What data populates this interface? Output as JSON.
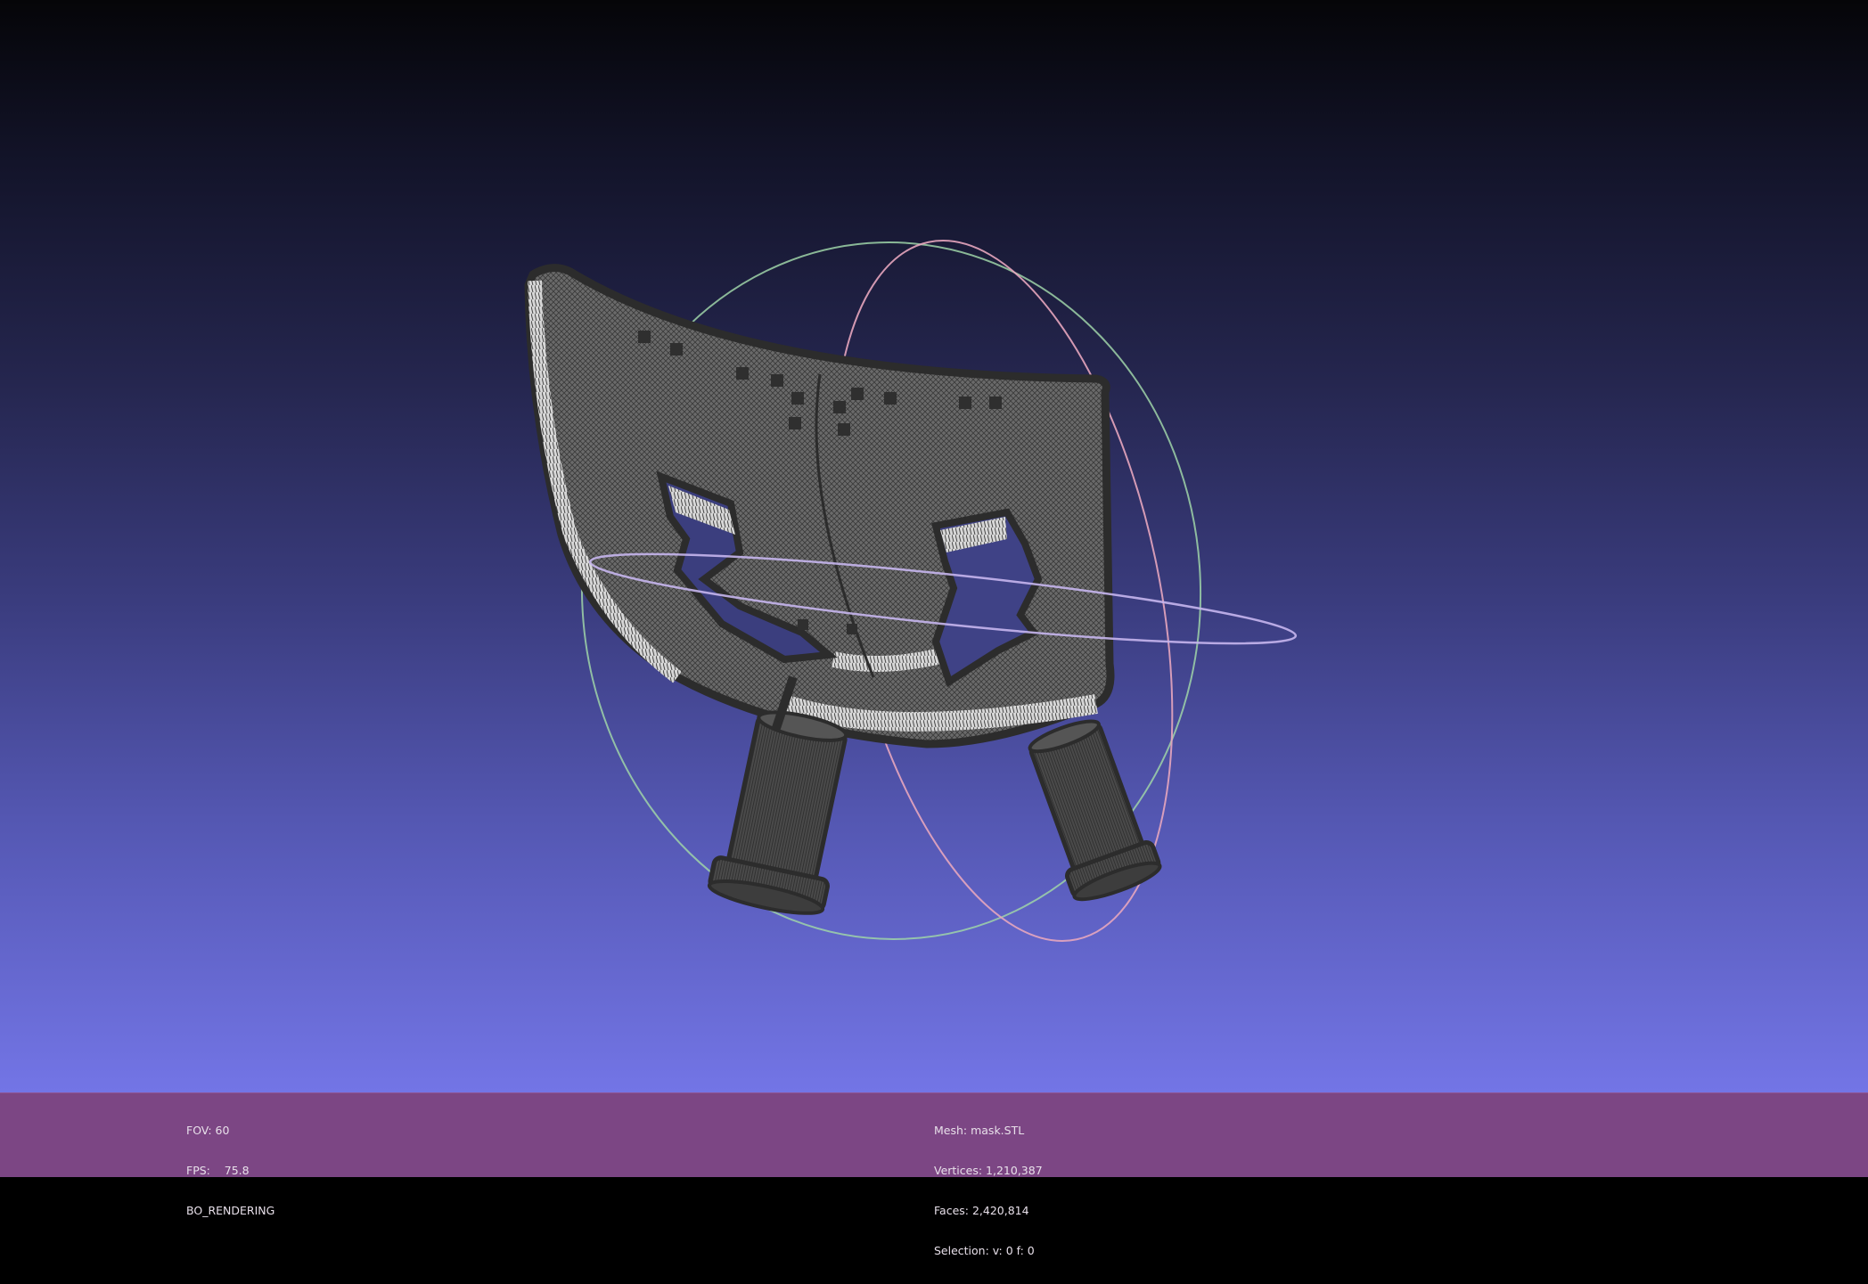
{
  "viewport": {
    "scene": "mesh-wireframe-viewer",
    "colors": {
      "bg_top": "#050508",
      "bg_bottom": "#7375e6",
      "mesh": "#5a5a5a",
      "mesh_edge": "#2f2f2f",
      "trackball_x": "#c8a9e8",
      "trackball_y": "#a8d8b0",
      "trackball_z": "#e8a0b8"
    }
  },
  "status_left": {
    "fov_label": "FOV: 60",
    "fps_label": "FPS:    75.8",
    "render_mode": "BO_RENDERING"
  },
  "status_right": {
    "mesh_label": "Mesh: mask.STL",
    "vertices_label": "Vertices: 1,210,387",
    "faces_label": "Faces: 2,420,814",
    "selection_label": "Selection: v: 0 f: 0"
  },
  "statusbar": {
    "color": "#7c4684"
  }
}
